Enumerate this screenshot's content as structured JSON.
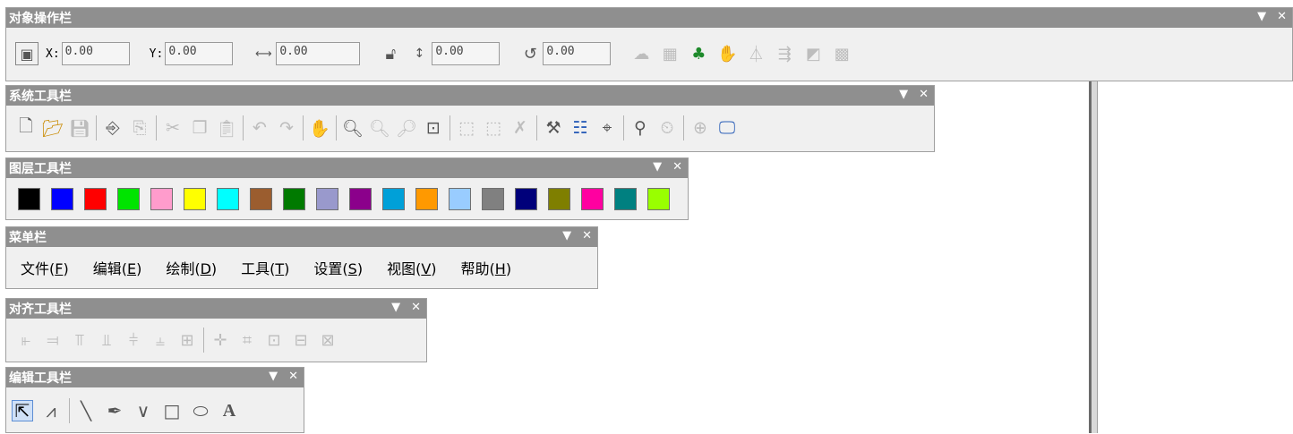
{
  "object_bar": {
    "title": "对象操作栏",
    "fields": {
      "x_label": "X:",
      "x_value": "0.00",
      "y_label": "Y:",
      "y_value": "0.00",
      "w_value": "0.00",
      "h_value": "0.00",
      "r_value": "0.00"
    },
    "icons": [
      "grid-anchor-icon",
      "width-icon",
      "lock-icon",
      "height-icon",
      "rotate-icon",
      "cloud-icon",
      "group-icon",
      "tree-icon",
      "ungroup-icon",
      "mirror-icon",
      "flip-icon",
      "export-icon",
      "pattern-icon"
    ]
  },
  "system_bar": {
    "title": "系统工具栏"
  },
  "layer_bar": {
    "title": "图层工具栏",
    "colors": [
      "#000000",
      "#0000ff",
      "#ff0000",
      "#00e400",
      "#ff9ccc",
      "#ffff00",
      "#00ffff",
      "#9b5d2f",
      "#007a00",
      "#9999cc",
      "#8b008b",
      "#00a0d8",
      "#ff9900",
      "#99ccff",
      "#808080",
      "#00007a",
      "#7f7f00",
      "#ff00a0",
      "#008080",
      "#99ff00"
    ]
  },
  "menu_bar": {
    "title": "菜单栏",
    "items": [
      {
        "pre": "文件(",
        "key": "F",
        "post": ")"
      },
      {
        "pre": "编辑(",
        "key": "E",
        "post": ")"
      },
      {
        "pre": "绘制(",
        "key": "D",
        "post": ")"
      },
      {
        "pre": "工具(",
        "key": "T",
        "post": ")"
      },
      {
        "pre": "设置(",
        "key": "S",
        "post": ")"
      },
      {
        "pre": "视图(",
        "key": "V",
        "post": ")"
      },
      {
        "pre": "帮助(",
        "key": "H",
        "post": ")"
      }
    ]
  },
  "align_bar": {
    "title": "对齐工具栏"
  },
  "edit_bar": {
    "title": "编辑工具栏"
  },
  "window_controls": {
    "dropdown": "▼",
    "close": "✕"
  }
}
